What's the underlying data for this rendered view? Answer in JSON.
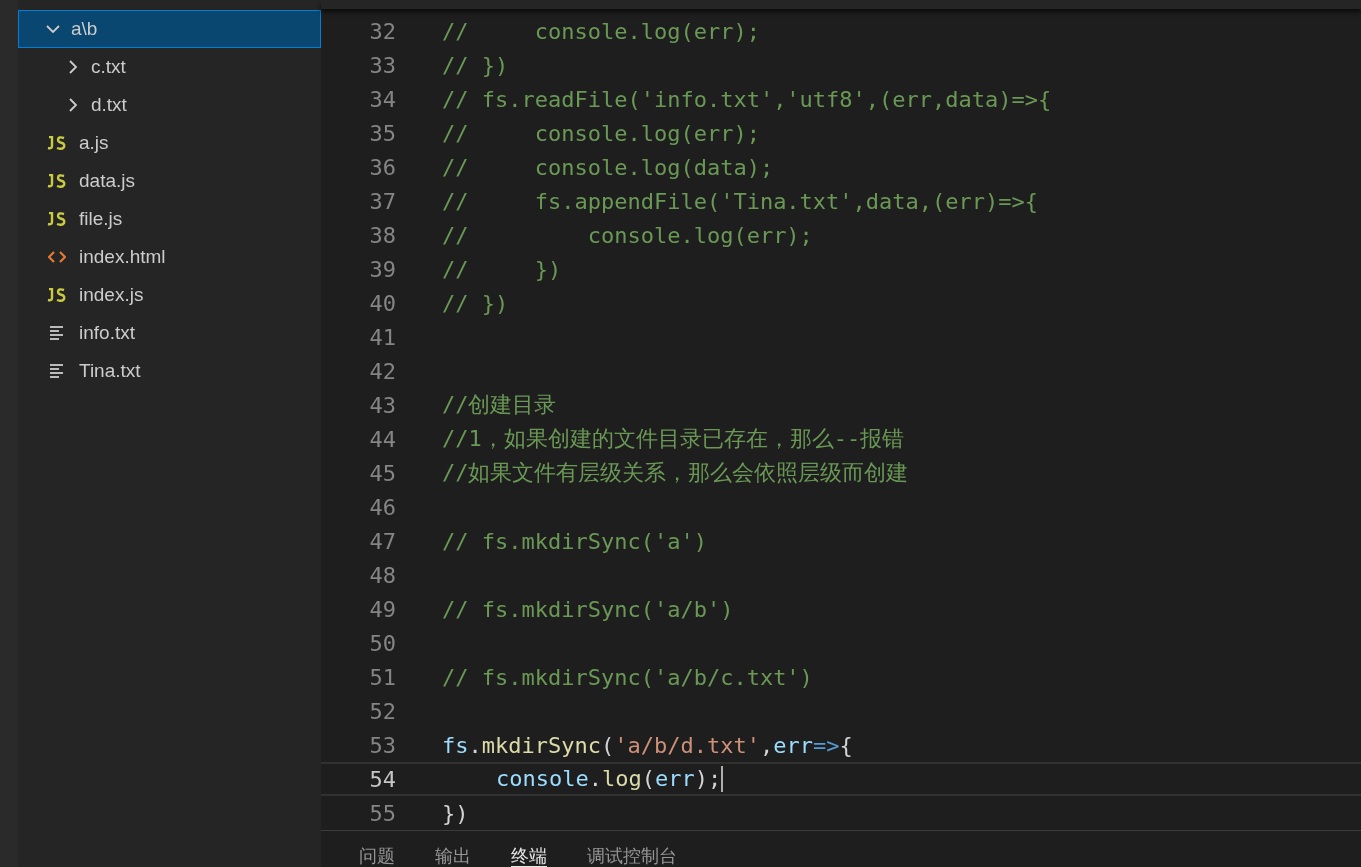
{
  "explorer": {
    "items": [
      {
        "label": "a\\b",
        "kind": "folder",
        "expanded": true,
        "selected": true,
        "children": [
          {
            "label": "c.txt",
            "kind": "folder",
            "expanded": false,
            "selected": false
          },
          {
            "label": "d.txt",
            "kind": "folder",
            "expanded": false,
            "selected": false
          }
        ]
      },
      {
        "label": "a.js",
        "kind": "js",
        "selected": false
      },
      {
        "label": "data.js",
        "kind": "js",
        "selected": false
      },
      {
        "label": "file.js",
        "kind": "js",
        "selected": false
      },
      {
        "label": "index.html",
        "kind": "html",
        "selected": false
      },
      {
        "label": "index.js",
        "kind": "js",
        "selected": false
      },
      {
        "label": "info.txt",
        "kind": "text",
        "selected": false
      },
      {
        "label": "Tina.txt",
        "kind": "text",
        "selected": false
      }
    ]
  },
  "editor": {
    "lines": [
      {
        "number": "32",
        "current": false,
        "tokens": [
          {
            "text": "//     console.log(err);",
            "kind": "comment"
          }
        ]
      },
      {
        "number": "33",
        "current": false,
        "tokens": [
          {
            "text": "// })",
            "kind": "comment"
          }
        ]
      },
      {
        "number": "34",
        "current": false,
        "tokens": [
          {
            "text": "// fs.readFile('info.txt','utf8',(err,data)=>{",
            "kind": "comment"
          }
        ]
      },
      {
        "number": "35",
        "current": false,
        "tokens": [
          {
            "text": "//     console.log(err);",
            "kind": "comment"
          }
        ]
      },
      {
        "number": "36",
        "current": false,
        "tokens": [
          {
            "text": "//     console.log(data);",
            "kind": "comment"
          }
        ]
      },
      {
        "number": "37",
        "current": false,
        "tokens": [
          {
            "text": "//     fs.appendFile('Tina.txt',data,(err)=>{",
            "kind": "comment"
          }
        ]
      },
      {
        "number": "38",
        "current": false,
        "tokens": [
          {
            "text": "//         console.log(err);",
            "kind": "comment"
          }
        ]
      },
      {
        "number": "39",
        "current": false,
        "tokens": [
          {
            "text": "//     })",
            "kind": "comment"
          }
        ]
      },
      {
        "number": "40",
        "current": false,
        "tokens": [
          {
            "text": "// })",
            "kind": "comment"
          }
        ]
      },
      {
        "number": "41",
        "current": false
      },
      {
        "number": "42",
        "current": false
      },
      {
        "number": "43",
        "current": false,
        "tokens": [
          {
            "text": "//创建目录",
            "kind": "comment"
          }
        ]
      },
      {
        "number": "44",
        "current": false,
        "tokens": [
          {
            "text": "//1，如果创建的文件目录已存在，那么--报错",
            "kind": "comment"
          }
        ]
      },
      {
        "number": "45",
        "current": false,
        "tokens": [
          {
            "text": "//如果文件有层级关系，那么会依照层级而创建",
            "kind": "comment"
          }
        ]
      },
      {
        "number": "46",
        "current": false
      },
      {
        "number": "47",
        "current": false,
        "tokens": [
          {
            "text": "// fs.mkdirSync('a')",
            "kind": "comment"
          }
        ]
      },
      {
        "number": "48",
        "current": false
      },
      {
        "number": "49",
        "current": false,
        "tokens": [
          {
            "text": "// fs.mkdirSync('a/b')",
            "kind": "comment"
          }
        ]
      },
      {
        "number": "50",
        "current": false
      },
      {
        "number": "51",
        "current": false,
        "tokens": [
          {
            "text": "// fs.mkdirSync('a/b/c.txt')",
            "kind": "comment"
          }
        ]
      },
      {
        "number": "52",
        "current": false
      },
      {
        "number": "53",
        "current": false,
        "tokens": [
          {
            "text": "fs",
            "kind": "variable"
          },
          {
            "text": ".",
            "kind": "plain"
          },
          {
            "text": "mkdirSync",
            "kind": "function"
          },
          {
            "text": "(",
            "kind": "plain"
          },
          {
            "text": "'a/b/d.txt'",
            "kind": "string"
          },
          {
            "text": ",",
            "kind": "plain"
          },
          {
            "text": "err",
            "kind": "variable"
          },
          {
            "text": "=>",
            "kind": "keyword"
          },
          {
            "text": "{",
            "kind": "plain"
          }
        ]
      },
      {
        "number": "54",
        "current": true,
        "indented": true,
        "tokens": [
          {
            "text": "console",
            "kind": "variable"
          },
          {
            "text": ".",
            "kind": "plain"
          },
          {
            "text": "log",
            "kind": "function"
          },
          {
            "text": "(",
            "kind": "plain"
          },
          {
            "text": "err",
            "kind": "variable"
          },
          {
            "text": ")",
            "kind": "plain"
          },
          {
            "text": ";",
            "kind": "plain"
          }
        ]
      },
      {
        "number": "55",
        "current": false,
        "tokens": [
          {
            "text": "})",
            "kind": "plain"
          }
        ]
      }
    ]
  },
  "panel": {
    "tabs": [
      {
        "label": "问题",
        "selected": false
      },
      {
        "label": "输出",
        "selected": false
      },
      {
        "label": "终端",
        "selected": true
      },
      {
        "label": "调试控制台",
        "selected": false
      }
    ]
  }
}
